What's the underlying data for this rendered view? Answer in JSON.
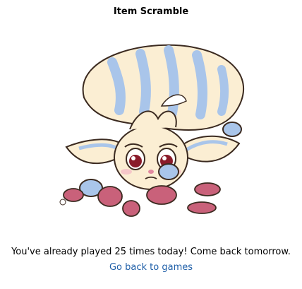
{
  "game": {
    "title": "Item Scramble"
  },
  "status": {
    "message": "You've already played 25 times today! Come back tomorrow."
  },
  "navigation": {
    "back_link_label": "Go back to games"
  },
  "illustration": {
    "icon": "sad-pet-illustration"
  },
  "colors": {
    "link": "#1f5fa8",
    "pet_fur": "#fbeed3",
    "pet_stripes": "#a9c5ea",
    "food": "#c9617a"
  }
}
